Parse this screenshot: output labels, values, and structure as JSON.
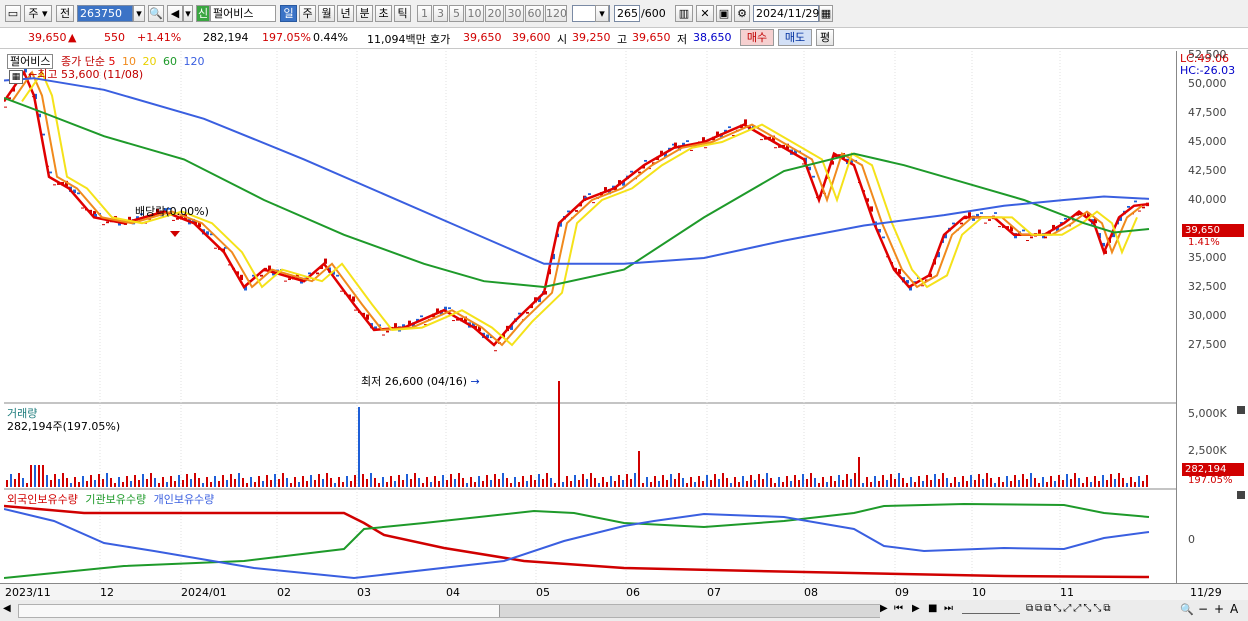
{
  "toolbar": {
    "period_select": "주",
    "prev_label": "전",
    "code_value": "263750",
    "stock_name_prefix": "신",
    "stock_name": "펄어비스",
    "timeframes": [
      "일",
      "주",
      "월",
      "년",
      "분",
      "초",
      "틱"
    ],
    "intervals": [
      "1",
      "3",
      "5",
      "10",
      "20",
      "30",
      "60",
      "120"
    ],
    "count_value": "265",
    "count_total": "/600",
    "date_value": "2024/11/29"
  },
  "quote": {
    "price": "39,650",
    "change": "550",
    "change_pct": "+1.41%",
    "volume": "282,194",
    "volume_ratio": "197.05%",
    "turnover": "0.44%",
    "amount": "11,094백만",
    "bid_label": "호가",
    "bid1": "39,650",
    "bid2": "39,600",
    "open_label": "시",
    "open": "39,250",
    "high_label": "고",
    "high": "39,650",
    "low_label": "저",
    "low": "38,650",
    "buy_label": "매수",
    "sell_label": "매도",
    "eval_label": "평"
  },
  "price_panel": {
    "name": "펄어비스",
    "ma_label": "종가 단순",
    "ma_periods": [
      "5",
      "10",
      "20",
      "60",
      "120"
    ],
    "high_marker": "최고 53,600 (11/08)",
    "low_marker": "최저 26,600 (04/16)",
    "dividend_label": "배당락(0.00%)",
    "lc": "LC:49.06",
    "hc": "HC:-26.03",
    "y_ticks": [
      "52,500",
      "50,000",
      "47,500",
      "45,000",
      "42,500",
      "40,000",
      "37,500",
      "35,000",
      "32,500",
      "30,000",
      "27,500"
    ],
    "current_price": "39,650",
    "current_pct": "1.41%"
  },
  "volume_panel": {
    "title": "거래량",
    "value": "282,194주(197.05%)",
    "y_ticks": [
      "5,000K",
      "2,500K"
    ],
    "current_volume": "282,194",
    "current_pct": "197.05%"
  },
  "holding_panel": {
    "series": [
      "외국인보유수량",
      "기관보유수량",
      "개인보유수량"
    ],
    "zero_label": "0"
  },
  "x_axis": [
    "2023/11",
    "12",
    "2024/01",
    "02",
    "03",
    "04",
    "05",
    "06",
    "07",
    "08",
    "09",
    "10",
    "11",
    "11/29"
  ],
  "colors": {
    "ma5": "#e00000",
    "ma10": "#f08a1c",
    "ma20": "#f5e21a",
    "ma60": "#1e9a2a",
    "ma120": "#3a5fe0",
    "up": "#d00000",
    "down": "#1e5fd8"
  }
}
